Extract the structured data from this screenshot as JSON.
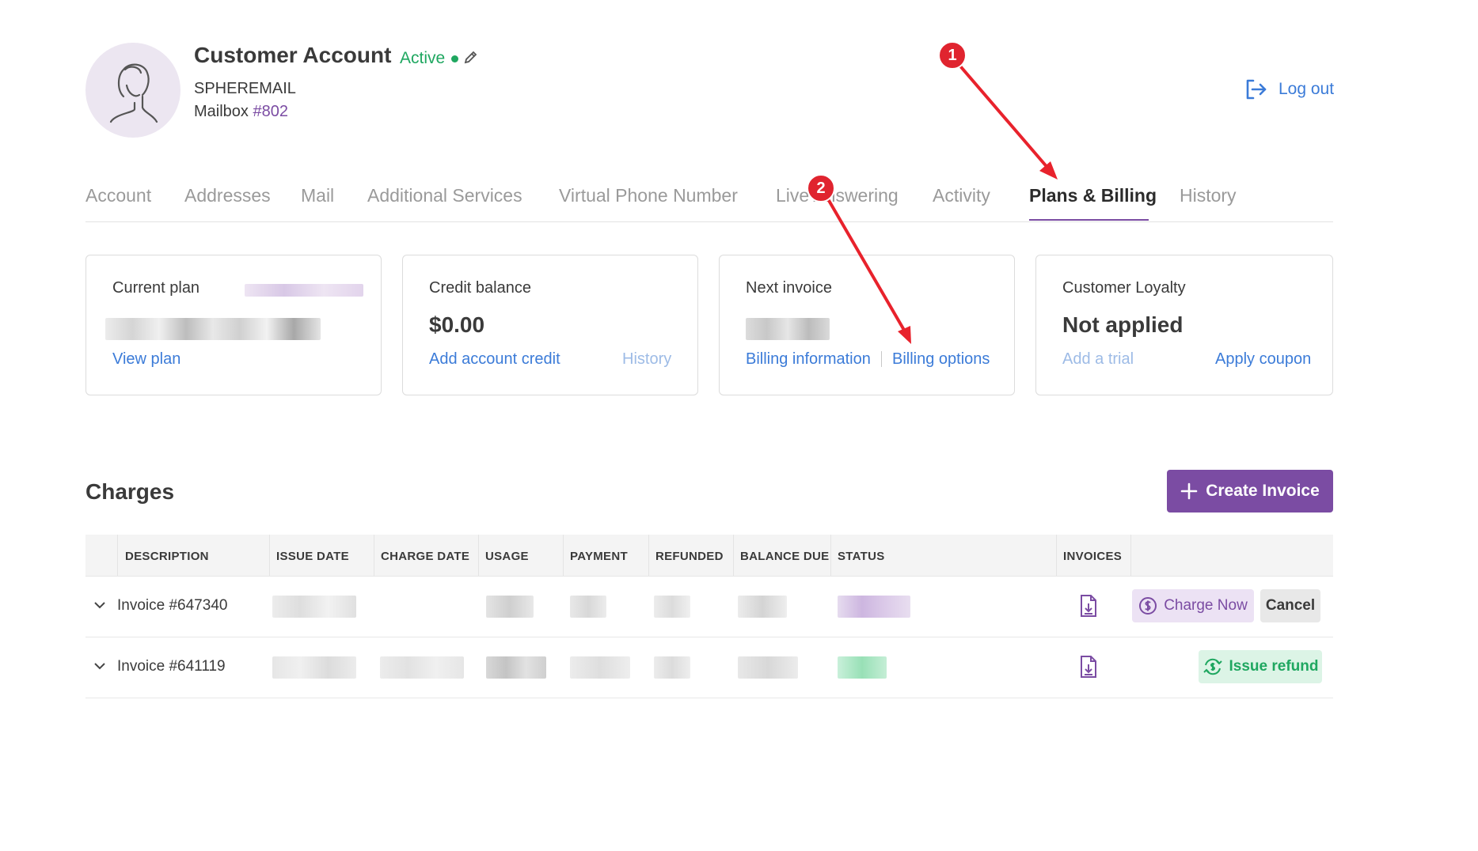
{
  "header": {
    "title": "Customer Account",
    "status": "Active",
    "company": "SPHEREMAIL",
    "mailbox_label": "Mailbox",
    "mailbox_number": "#802",
    "logout_label": "Log out"
  },
  "tabs": [
    {
      "label": "Account"
    },
    {
      "label": "Addresses"
    },
    {
      "label": "Mail"
    },
    {
      "label": "Additional Services"
    },
    {
      "label": "Virtual Phone Number"
    },
    {
      "label": "Live Answering"
    },
    {
      "label": "Activity"
    },
    {
      "label": "Plans & Billing",
      "active": true
    },
    {
      "label": "History"
    }
  ],
  "cards": {
    "current_plan": {
      "label": "Current plan",
      "link": "View plan"
    },
    "credit_balance": {
      "label": "Credit balance",
      "value": "$0.00",
      "link": "Add account credit",
      "history_link": "History"
    },
    "next_invoice": {
      "label": "Next invoice",
      "link1": "Billing information",
      "link2": "Billing options"
    },
    "customer_loyalty": {
      "label": "Customer Loyalty",
      "value": "Not applied",
      "link1": "Add a trial",
      "link2": "Apply coupon"
    }
  },
  "charges": {
    "title": "Charges",
    "create_button": "Create Invoice",
    "columns": [
      "DESCRIPTION",
      "ISSUE DATE",
      "CHARGE DATE",
      "USAGE",
      "PAYMENT",
      "REFUNDED",
      "BALANCE DUE",
      "STATUS",
      "INVOICES"
    ],
    "rows": [
      {
        "description": "Invoice #647340",
        "actions": [
          "Charge Now",
          "Cancel"
        ]
      },
      {
        "description": "Invoice #641119",
        "actions": [
          "Issue refund"
        ]
      }
    ]
  },
  "annotations": [
    "1",
    "2"
  ],
  "colors": {
    "accent": "#7b4ca3",
    "link": "#3b7bd8",
    "active_status": "#1fa760",
    "annotation": "#e0242f"
  },
  "icons": [
    "avatar-silhouette-icon",
    "pencil-icon",
    "logout-icon",
    "plus-icon",
    "chevron-down-icon",
    "file-download-icon",
    "dollar-circle-icon",
    "refund-icon"
  ]
}
